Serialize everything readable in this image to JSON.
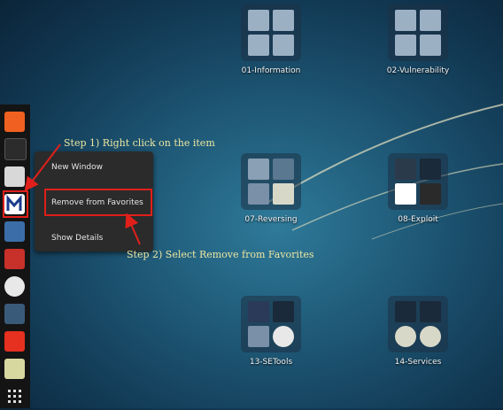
{
  "folders": [
    {
      "label": "01-Information"
    },
    {
      "label": "02-Vulnerability"
    },
    {
      "label": "07-Reversing"
    },
    {
      "label": "08-Exploit"
    },
    {
      "label": "13-SETools"
    },
    {
      "label": "14-Services"
    }
  ],
  "context_menu": {
    "items": [
      "New Window",
      "Remove from Favorites",
      "Show Details"
    ]
  },
  "annotations": {
    "step1": "Step 1) Right click on the item",
    "step2": "Step 2) Select Remove from Favorites"
  },
  "dock": {
    "icons": [
      "firefox-icon",
      "terminal-icon",
      "files-icon",
      "metasploit-icon",
      "faraday-icon",
      "armitage-icon",
      "maltego-icon",
      "kali-tool-icon",
      "flashrom-icon",
      "notes-icon",
      "apps-grid-icon"
    ]
  },
  "colors": {
    "accent": "#e0201a",
    "annotation_text": "#ece6a0"
  }
}
